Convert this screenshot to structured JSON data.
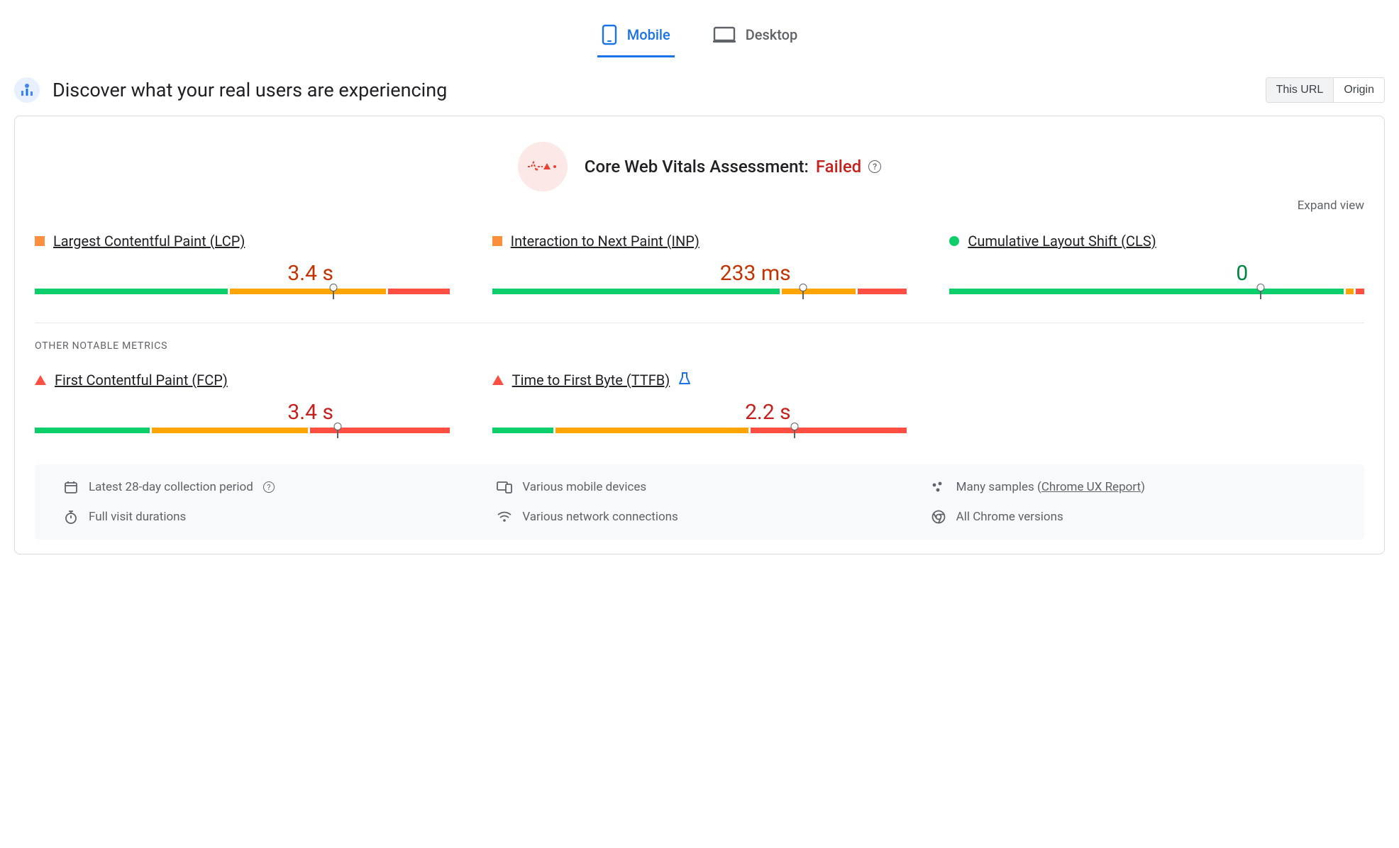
{
  "tabs": {
    "mobile": "Mobile",
    "desktop": "Desktop",
    "active": "mobile"
  },
  "header": {
    "title": "Discover what your real users are experiencing",
    "scope": {
      "this_url": "This URL",
      "origin": "Origin",
      "active": "this_url"
    }
  },
  "assessment": {
    "label": "Core Web Vitals Assessment:",
    "status": "Failed"
  },
  "expand_label": "Expand view",
  "metrics": {
    "lcp": {
      "name": "Largest Contentful Paint (LCP)",
      "value": "3.4 s",
      "rating": "orange",
      "dist": {
        "green": 47,
        "orange": 38,
        "red": 15
      },
      "marker": 72
    },
    "inp": {
      "name": "Interaction to Next Paint (INP)",
      "value": "233 ms",
      "rating": "orange",
      "dist": {
        "green": 70,
        "orange": 18,
        "red": 12
      },
      "marker": 75
    },
    "cls": {
      "name": "Cumulative Layout Shift (CLS)",
      "value": "0",
      "rating": "green",
      "dist": {
        "green": 96,
        "orange": 2,
        "red": 2
      },
      "marker": 75
    },
    "fcp": {
      "name": "First Contentful Paint (FCP)",
      "value": "3.4 s",
      "rating": "red",
      "dist": {
        "green": 28,
        "orange": 38,
        "red": 34
      },
      "marker": 73
    },
    "ttfb": {
      "name": "Time to First Byte (TTFB)",
      "value": "2.2 s",
      "rating": "red",
      "dist": {
        "green": 15,
        "orange": 47,
        "red": 38
      },
      "marker": 73
    }
  },
  "other_metrics_label": "OTHER NOTABLE METRICS",
  "footer": {
    "period": "Latest 28-day collection period",
    "devices": "Various mobile devices",
    "samples_prefix": "Many samples (",
    "samples_link": "Chrome UX Report",
    "samples_suffix": ")",
    "durations": "Full visit durations",
    "networks": "Various network connections",
    "versions": "All Chrome versions"
  }
}
